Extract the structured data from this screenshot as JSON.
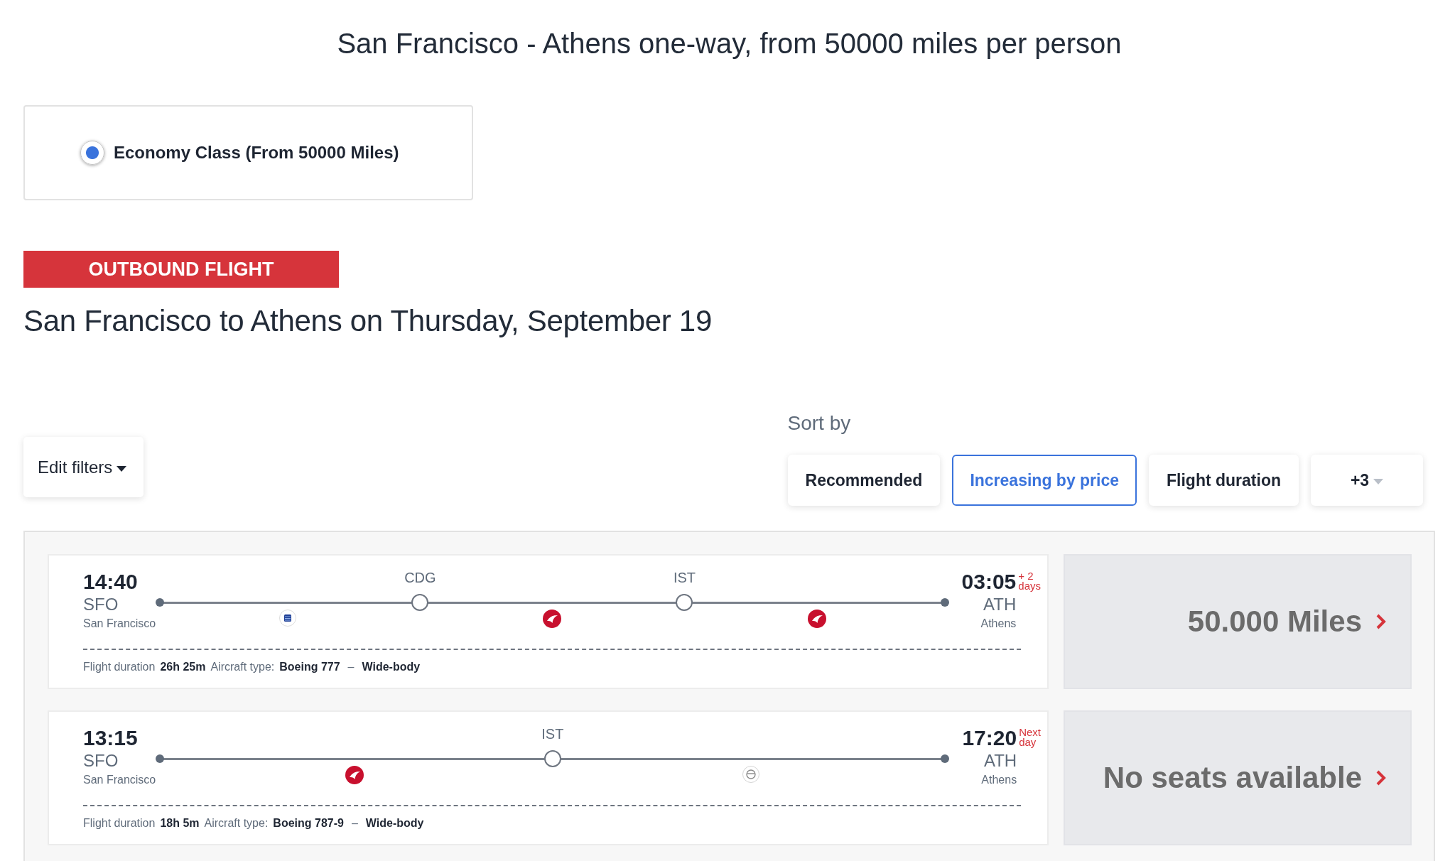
{
  "page_title": "San Francisco - Athens one-way, from 50000 miles per person",
  "cabin_classes": [
    {
      "label": "Economy Class (From 50000 Miles)",
      "selected": true
    }
  ],
  "section_banner": "OUTBOUND FLIGHT",
  "route_heading": "San Francisco to Athens on Thursday, September 19",
  "filters_button": {
    "label": "Edit filters"
  },
  "sort": {
    "label": "Sort by",
    "options": [
      {
        "label": "Recommended",
        "selected": false
      },
      {
        "label": "Increasing by price",
        "selected": true
      },
      {
        "label": "Flight duration",
        "selected": false
      }
    ],
    "more": {
      "label": "+3"
    }
  },
  "flights": [
    {
      "departure": {
        "time": "14:40",
        "code": "SFO",
        "city": "San Francisco"
      },
      "stops": [
        {
          "code": "CDG"
        },
        {
          "code": "IST"
        }
      ],
      "legs": [
        {
          "kind": "globe"
        },
        {
          "kind": "bird"
        },
        {
          "kind": "bird"
        }
      ],
      "arrival": {
        "time": "03:05",
        "day_note": [
          "+ 2",
          "days"
        ],
        "code": "ATH",
        "city": "Athens"
      },
      "details": [
        {
          "kind": "label",
          "text": "Flight duration"
        },
        {
          "kind": "value",
          "text": "26h 25m"
        },
        {
          "kind": "label",
          "text": "Aircraft type:"
        },
        {
          "kind": "value",
          "text": "Boeing 777"
        },
        {
          "kind": "separator",
          "text": "–"
        },
        {
          "kind": "value",
          "text": "Wide-body"
        }
      ],
      "fare": "50.000 Miles"
    },
    {
      "departure": {
        "time": "13:15",
        "code": "SFO",
        "city": "San Francisco"
      },
      "stops": [
        {
          "code": "IST"
        }
      ],
      "legs": [
        {
          "kind": "bird"
        },
        {
          "kind": "crest"
        }
      ],
      "arrival": {
        "time": "17:20",
        "day_note": [
          "Next",
          "day"
        ],
        "code": "ATH",
        "city": "Athens"
      },
      "details": [
        {
          "kind": "label",
          "text": "Flight duration"
        },
        {
          "kind": "value",
          "text": "18h 5m"
        },
        {
          "kind": "label",
          "text": "Aircraft type:"
        },
        {
          "kind": "value",
          "text": "Boeing 787-9"
        },
        {
          "kind": "separator",
          "text": "–"
        },
        {
          "kind": "value",
          "text": "Wide-body"
        }
      ],
      "fare": "No seats available"
    }
  ]
}
